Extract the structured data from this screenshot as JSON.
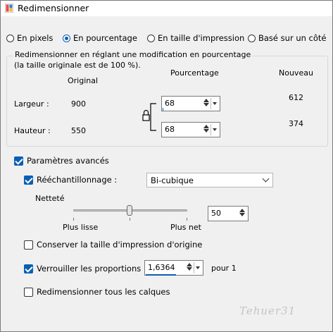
{
  "window": {
    "title": "Redimensionner"
  },
  "mode_options": [
    {
      "label": "En pixels",
      "selected": false
    },
    {
      "label": "En pourcentage",
      "selected": true
    },
    {
      "label": "En taille d'impression",
      "selected": false
    },
    {
      "label": "Basé sur un côté",
      "selected": false
    }
  ],
  "group": {
    "title": "Redimensionner en réglant une modification en pourcentage",
    "subtitle": "(la taille originale est de 100 %).",
    "col_original": "Original",
    "col_percent": "Pourcentage",
    "col_new": "Nouveau",
    "width": {
      "label": "Largeur :",
      "original": "900",
      "percent": "68",
      "new": "612"
    },
    "height": {
      "label": "Hauteur :",
      "original": "550",
      "percent": "68",
      "new": "374"
    }
  },
  "advanced": {
    "label": "Paramètres avancés",
    "checked": true,
    "resample_label": "Rééchantillonnage :",
    "resample_checked": true,
    "resample_value": "Bi-cubique",
    "sharpness_label": "Netteté",
    "sharpness_value": "50",
    "slider_min_label": "Plus lisse",
    "slider_max_label": "Plus net",
    "slider_level": 0.5
  },
  "keep_print_size": {
    "label": "Conserver la taille d'impression d'origine",
    "checked": false
  },
  "lock_ratio": {
    "label": "Verrouiller les proportions :",
    "checked": true,
    "value": "1,6364",
    "suffix": "pour 1"
  },
  "resize_all_layers": {
    "label": "Redimensionner tous les calques",
    "checked": false
  },
  "watermark": "Tehuer31"
}
